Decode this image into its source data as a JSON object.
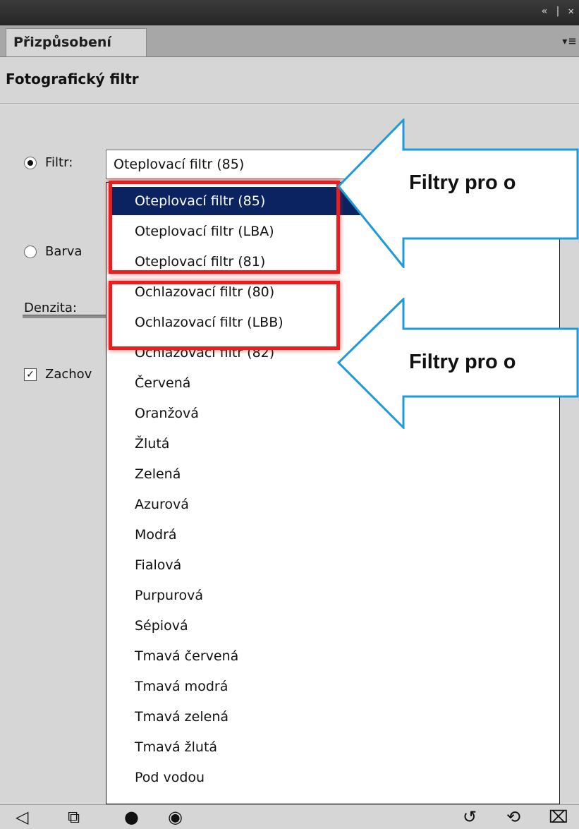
{
  "window": {
    "controls": "« | ✕",
    "tab_label": "Přizpůsobení",
    "panel_menu_icon": "▾≡"
  },
  "adjustment": {
    "heading": "Fotografický filtr",
    "filter_label": "Filtr:",
    "color_label": "Barva",
    "density_label": "Denzita:",
    "preserve_label": "Zachov",
    "checkbox_mark": "✓",
    "selected_filter": "Oteplovací filtr (85)"
  },
  "dropdown": {
    "items": [
      "Oteplovací filtr (85)",
      "Oteplovací filtr (LBA)",
      "Oteplovací filtr (81)",
      "Ochlazovací filtr (80)",
      "Ochlazovací filtr (LBB)",
      "Ochlazovací filtr (82)",
      "Červená",
      "Oranžová",
      "Žlutá",
      "Zelená",
      "Azurová",
      "Modrá",
      "Fialová",
      "Purpurová",
      "Sépiová",
      "Tmavá červená",
      "Tmavá modrá",
      "Tmavá zelená",
      "Tmavá žlutá",
      "Pod vodou"
    ],
    "selected_index": 0
  },
  "callouts": {
    "warm_text": "Filtry pro o",
    "cool_text": "Filtry pro o"
  },
  "bottom_bar": {
    "back_icon": "◁",
    "clip_icon": "⧉",
    "mask_icon": "●",
    "visibility_icon": "◉",
    "prev_state_icon": "↺",
    "reset_icon": "⟲",
    "trash_icon": "⌧"
  },
  "colors": {
    "selection": "#0b2361",
    "highlight_box": "#e81f1f",
    "callout_stroke": "#1e9ad6"
  }
}
